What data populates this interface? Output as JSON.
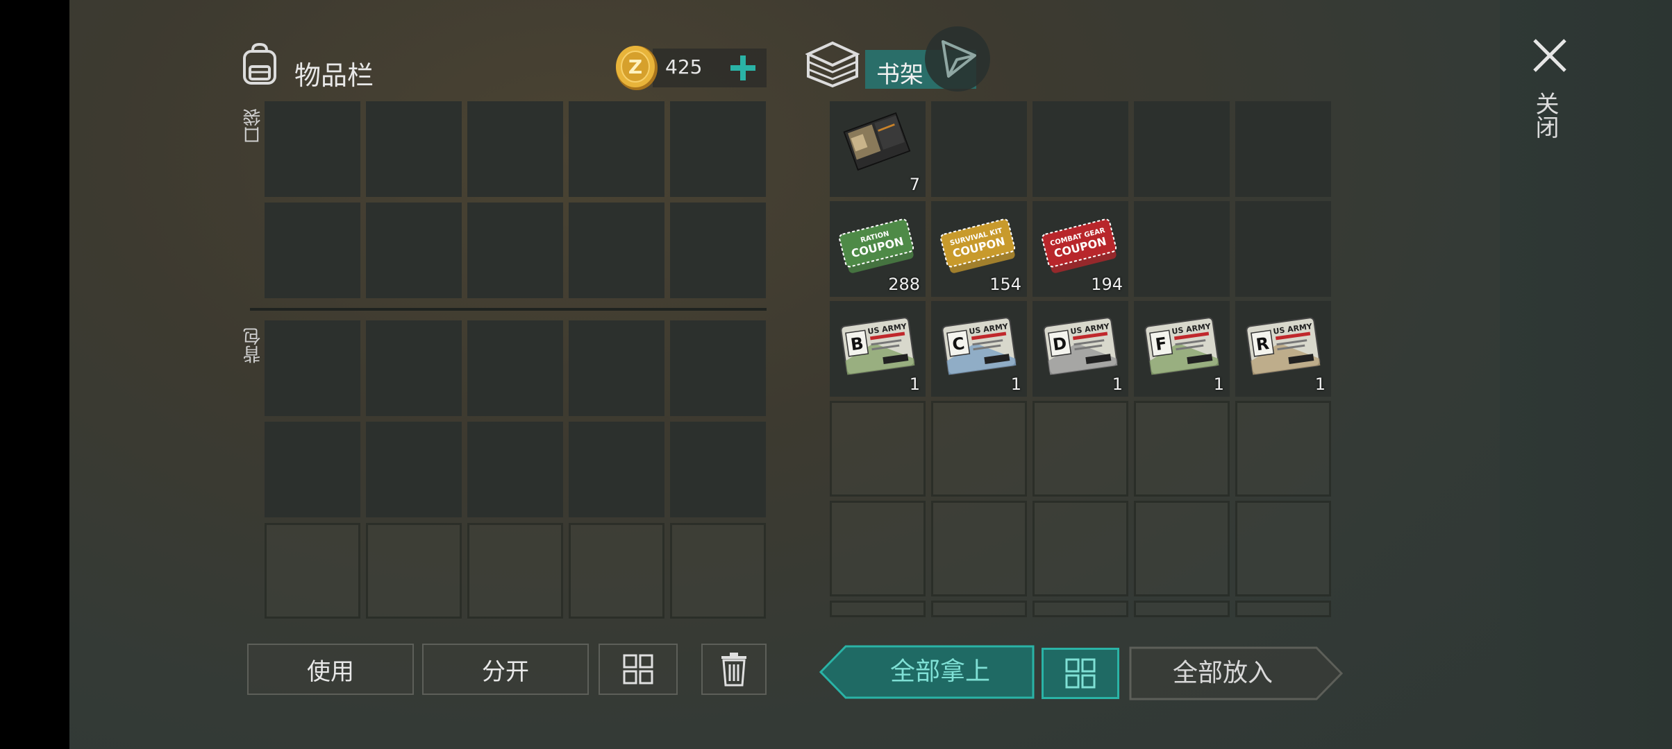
{
  "inventory": {
    "title": "物品栏",
    "coins": "425",
    "pocket_label": "口袋",
    "backpack_label": "背包"
  },
  "shelf": {
    "title": "书架",
    "items": [
      {
        "name": "wallet",
        "count": "7"
      },
      {
        "name": "ration-coupon",
        "line1": "RATION",
        "line2": "COUPON",
        "count": "288",
        "color": "#4e8a47"
      },
      {
        "name": "survival-kit-coupon",
        "line1": "SURVIVAL KIT",
        "line2": "COUPON",
        "count": "154",
        "color": "#c89a2c"
      },
      {
        "name": "combat-gear-coupon",
        "line1": "COMBAT GEAR",
        "line2": "COUPON",
        "count": "194",
        "color": "#b8262b"
      },
      {
        "name": "army-card-b",
        "letter": "B",
        "count": "1",
        "tint": "#8aa56d"
      },
      {
        "name": "army-card-c",
        "letter": "C",
        "count": "1",
        "tint": "#7ea3c4"
      },
      {
        "name": "army-card-d",
        "letter": "D",
        "count": "1",
        "tint": "#9a9a9a"
      },
      {
        "name": "army-card-f",
        "letter": "F",
        "count": "1",
        "tint": "#8aa56d"
      },
      {
        "name": "army-card-r",
        "letter": "R",
        "count": "1",
        "tint": "#b8a27a"
      }
    ],
    "card_header": "US ARMY"
  },
  "buttons": {
    "use": "使用",
    "split": "分开",
    "take_all": "全部拿上",
    "put_all": "全部放入"
  },
  "close_label": "关闭",
  "colors": {
    "accent": "#2ab3a6",
    "coin": "#e8b43a"
  }
}
